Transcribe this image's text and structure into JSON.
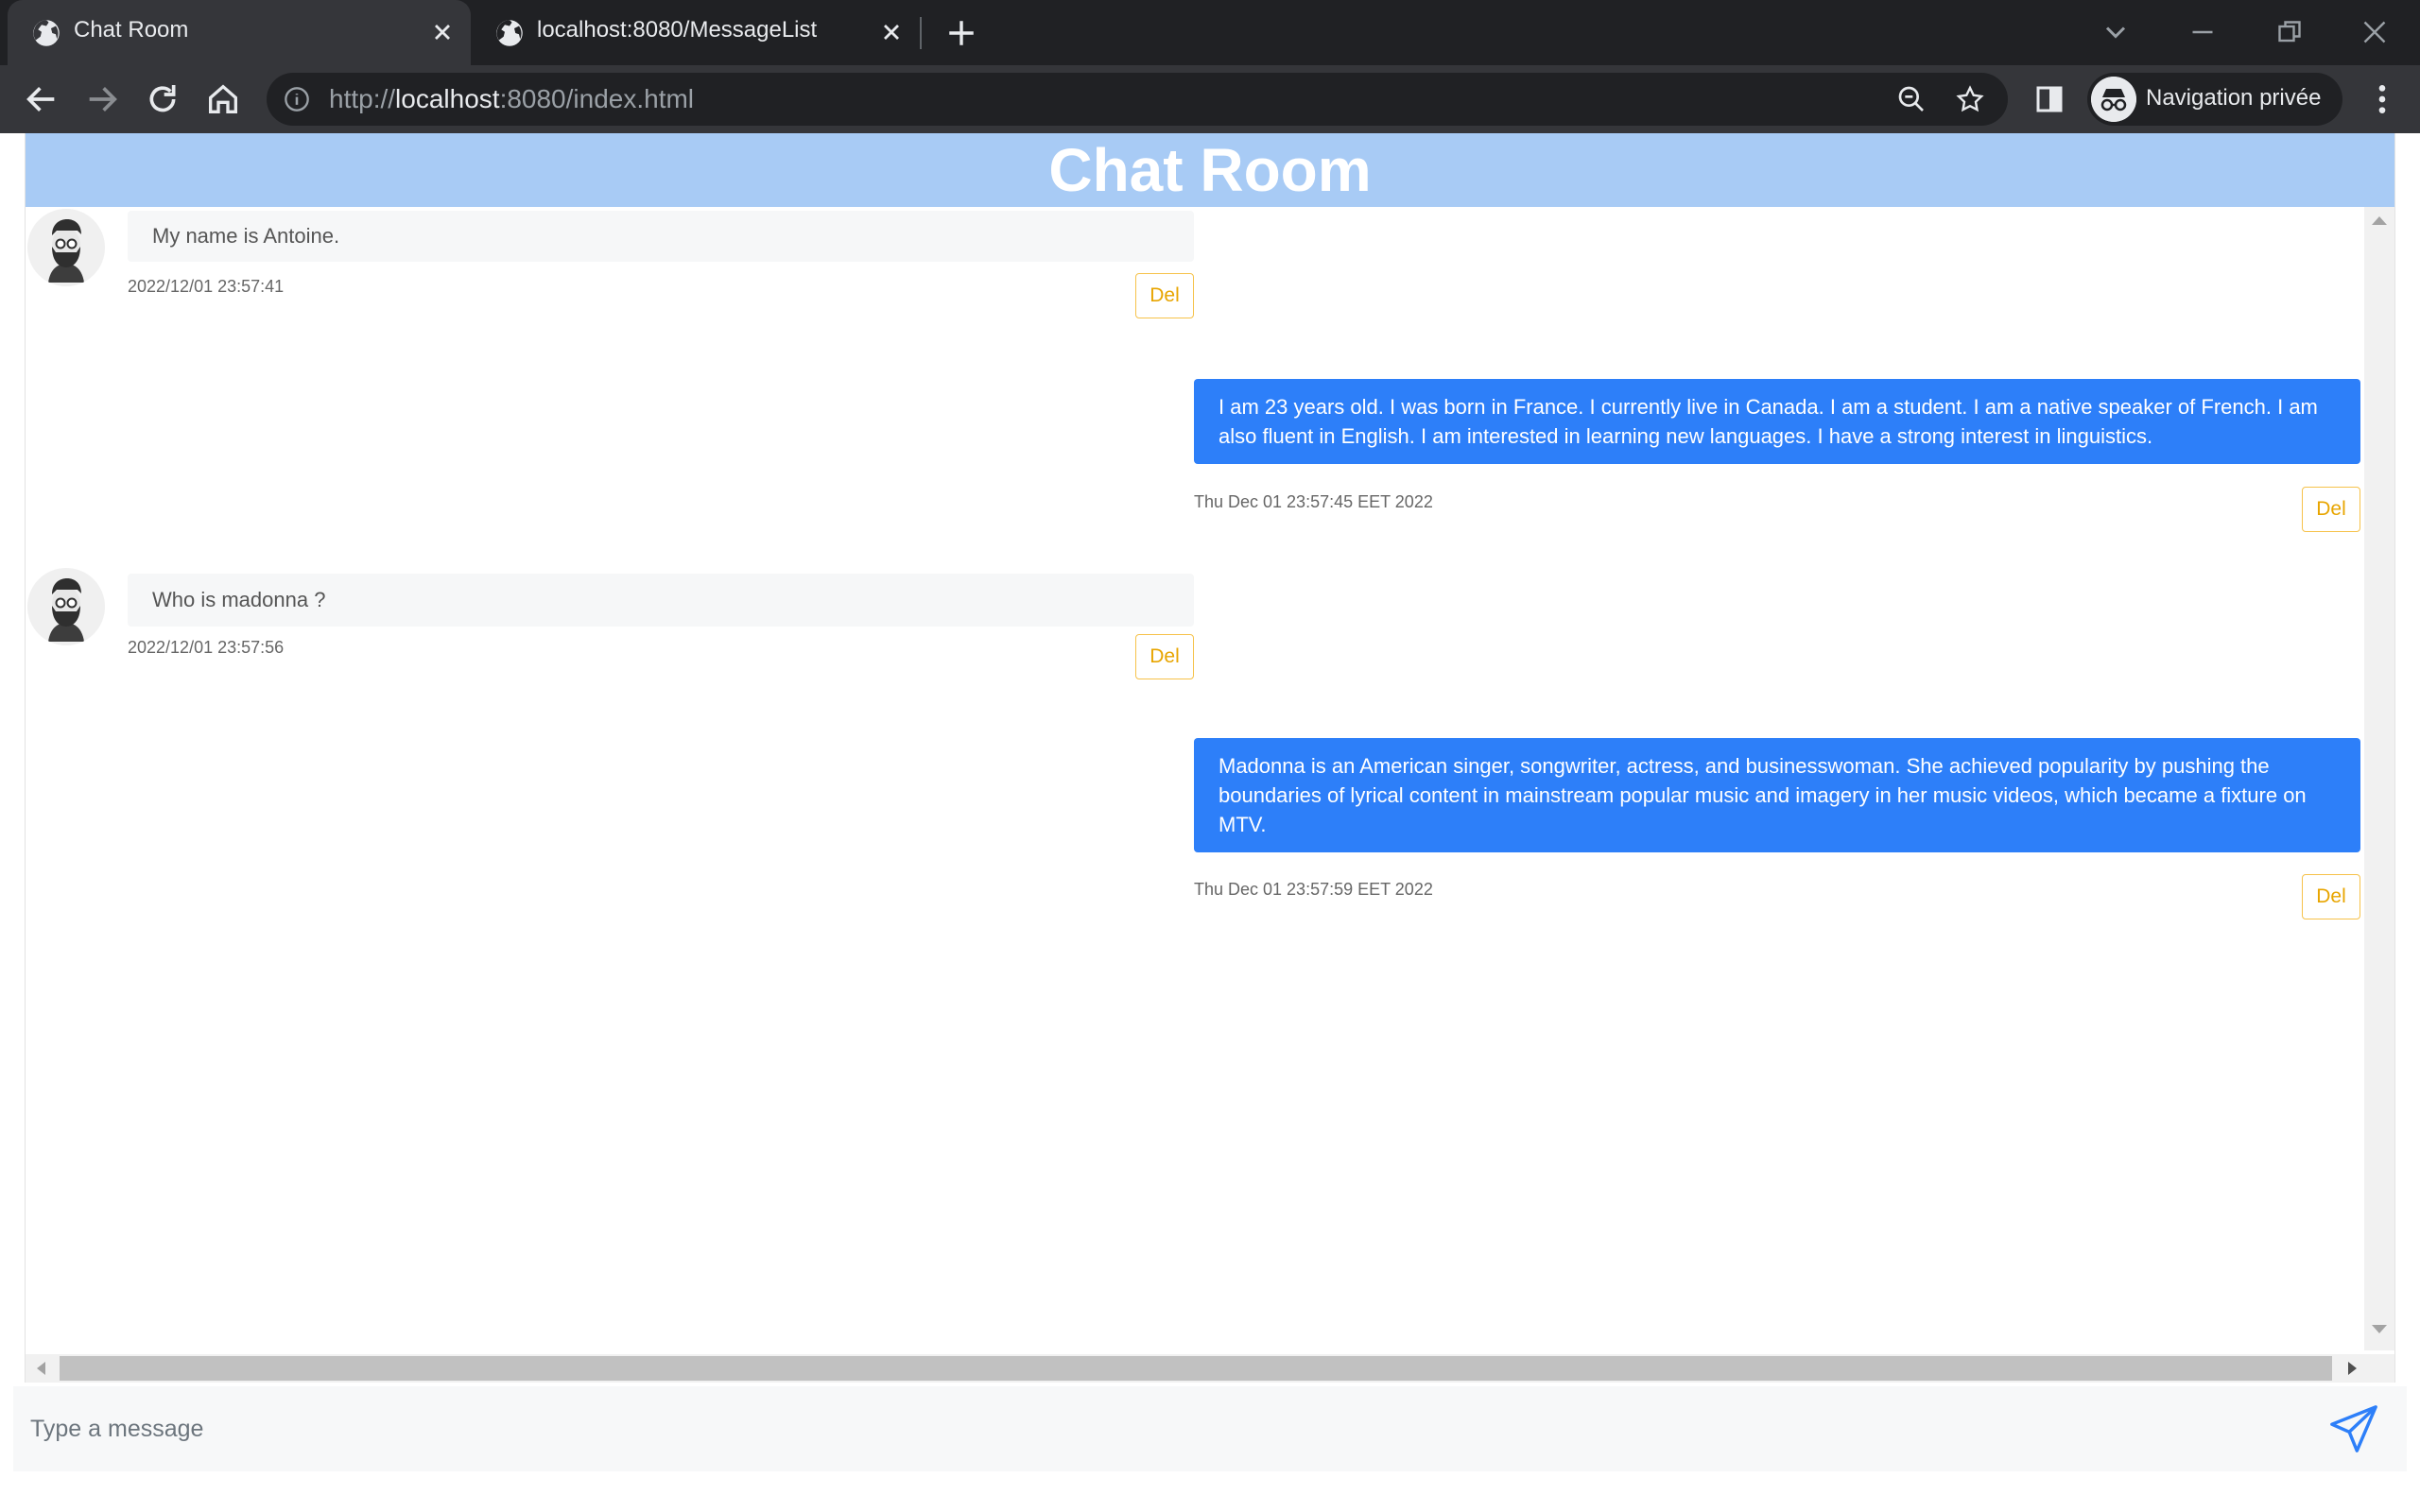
{
  "browser": {
    "tabs": [
      {
        "title": "Chat Room",
        "active": true
      },
      {
        "title": "localhost:8080/MessageList",
        "active": false
      }
    ],
    "address": {
      "scheme": "http://",
      "host": "localhost",
      "rest": ":8080/index.html"
    },
    "profile_label": "Navigation privée"
  },
  "chat": {
    "title": "Chat Room",
    "messages": [
      {
        "side": "received",
        "text": "My name is Antoine.",
        "time": "2022/12/01 23:57:41",
        "delete_label": "Del"
      },
      {
        "side": "sent",
        "text": "I am 23 years old. I was born in France. I currently live in Canada. I am a student. I am a native speaker of French. I am also fluent in English. I am interested in learning new languages. I have a strong interest in linguistics.",
        "time": "Thu Dec 01 23:57:45 EET 2022",
        "delete_label": "Del"
      },
      {
        "side": "received",
        "text": "Who is madonna ?",
        "time": "2022/12/01 23:57:56",
        "delete_label": "Del"
      },
      {
        "side": "sent",
        "text": "Madonna is an American singer, songwriter, actress, and businesswoman. She achieved popularity by pushing the boundaries of lyrical content in mainstream popular music and imagery in her music videos, which became a fixture on MTV.",
        "time": "Thu Dec 01 23:57:59 EET 2022",
        "delete_label": "Del"
      }
    ],
    "input_placeholder": "Type a message"
  },
  "colors": {
    "header_bg": "#a8cbf5",
    "sent_bubble": "#2d7ff9",
    "received_bubble": "#f6f7f8",
    "delete_accent": "#f6c24a"
  }
}
